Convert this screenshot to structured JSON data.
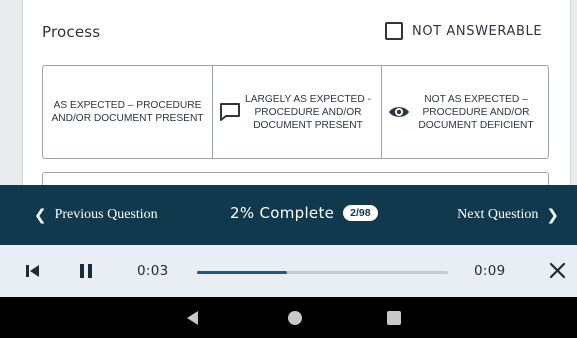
{
  "question": {
    "section_title": "Process",
    "not_answerable_label": "NOT ANSWERABLE",
    "not_answerable_checked": false,
    "options": [
      {
        "label": "AS EXPECTED – PROCEDURE AND/OR DOCUMENT PRESENT",
        "icon": ""
      },
      {
        "label": "LARGELY AS EXPECTED - PROCEDURE AND/OR DOCUMENT PRESENT",
        "icon": "comment-icon"
      },
      {
        "label": "NOT AS EXPECTED – PROCEDURE AND/OR DOCUMENT DEFICIENT",
        "icon": "eye-icon"
      }
    ]
  },
  "nav": {
    "previous_label": "Previous Question",
    "next_label": "Next Question",
    "progress_label": "2% Complete",
    "progress_count": "2/98",
    "progress_percent": 2
  },
  "player": {
    "current_time": "0:03",
    "duration": "0:09",
    "progress_fraction": 0.36
  },
  "colors": {
    "nav_background": "#10394d",
    "player_background": "#e9eef2",
    "player_fill": "#1f5a78",
    "text_dark": "#2b3642"
  }
}
